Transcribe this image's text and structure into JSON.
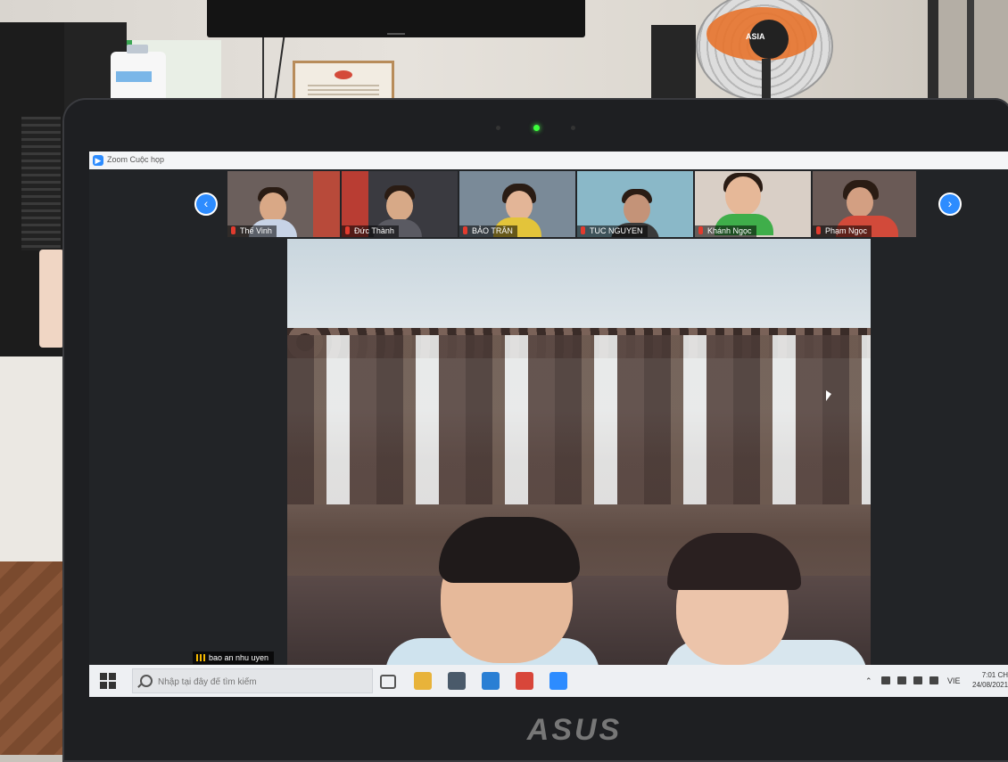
{
  "laptop": {
    "brand": "ASUS"
  },
  "room": {
    "fan_brand": "ASIA"
  },
  "window": {
    "title": "Zoom Cuộc họp"
  },
  "gallery": {
    "participants": [
      {
        "name": "Thế Vinh"
      },
      {
        "name": "Đức Thành"
      },
      {
        "name": "BẢO TRÂN"
      },
      {
        "name": "TUC NGUYEN"
      },
      {
        "name": "Khánh Ngọc"
      },
      {
        "name": "Phạm Ngọc"
      }
    ]
  },
  "main_video": {
    "speaker_name": "bao an nhu uyen"
  },
  "taskbar": {
    "search_placeholder": "Nhập tại đây để tìm kiếm",
    "language": "VIE",
    "clock_time": "7:01 CH",
    "clock_date": "24/08/2021"
  },
  "colors": {
    "zoom_blue": "#2d8cff",
    "mic_muted_red": "#e23b2e",
    "camera_led": "#3cff3c"
  }
}
